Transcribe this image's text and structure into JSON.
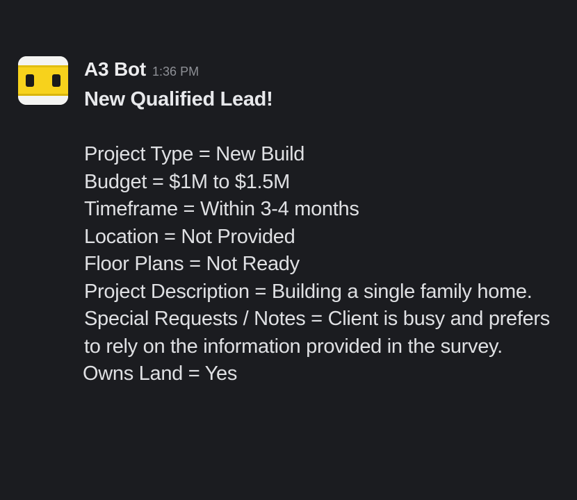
{
  "message": {
    "sender": "A3 Bot",
    "timestamp": "1:36 PM",
    "avatar_icon": "robot-face-icon",
    "headline": "New Qualified Lead!",
    "lines": [
      "Project Type = New Build",
      "Budget = $1M to $1.5M",
      "Timeframe = Within 3-4 months",
      "Location = Not Provided",
      "Floor Plans = Not Ready",
      "Project Description = Building a single family home.",
      "Special Requests / Notes = Client is busy and prefers to rely on the information provided in the survey.",
      "Owns Land = Yes"
    ]
  },
  "colors": {
    "background": "#1b1c20",
    "text": "#dfe0e3",
    "timestamp": "#8e9096",
    "avatar_yellow": "#f7d21c"
  }
}
